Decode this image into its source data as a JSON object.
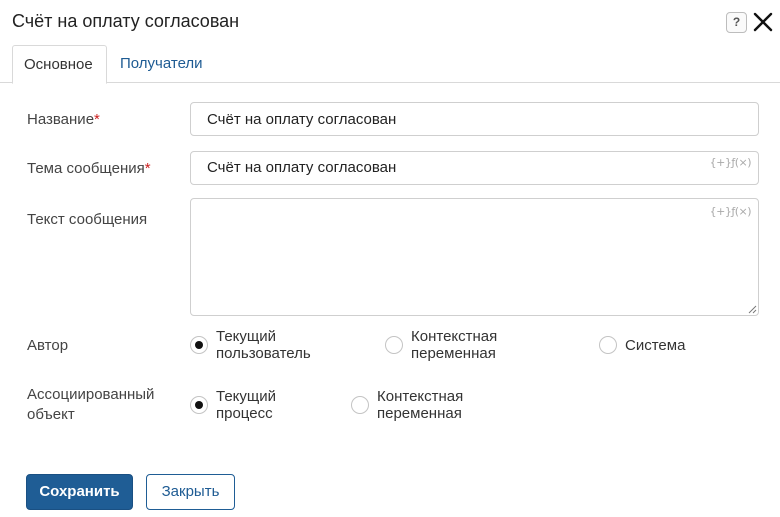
{
  "dialog": {
    "title": "Счёт на оплату согласован",
    "help_label": "?",
    "close_icon": "close-icon"
  },
  "tabs": [
    {
      "label": "Основное",
      "active": true
    },
    {
      "label": "Получатели",
      "active": false
    }
  ],
  "form": {
    "name": {
      "label": "Название",
      "required_mark": "*",
      "value": "Счёт на оплату согласован"
    },
    "subject": {
      "label": "Тема сообщения",
      "required_mark": "*",
      "value": "Счёт на оплату согласован",
      "expr_icon": "{+}ƒ(×)"
    },
    "body": {
      "label": "Текст сообщения",
      "value": "",
      "expr_icon": "{+}ƒ(×)"
    },
    "author": {
      "label": "Автор",
      "options": [
        {
          "label": "Текущий пользователь",
          "checked": true
        },
        {
          "label": "Контекстная переменная",
          "checked": false
        },
        {
          "label": "Система",
          "checked": false
        }
      ]
    },
    "associated": {
      "label_line1": "Ассоциированный",
      "label_line2": "объект",
      "options": [
        {
          "label": "Текущий процесс",
          "checked": true
        },
        {
          "label": "Контекстная переменная",
          "checked": false
        }
      ]
    }
  },
  "actions": {
    "save_label": "Сохранить",
    "close_label": "Закрыть"
  },
  "colors": {
    "primary": "#1f5d95",
    "link": "#1e5b93",
    "required": "#cc2020",
    "border": "#cfcfcf"
  }
}
